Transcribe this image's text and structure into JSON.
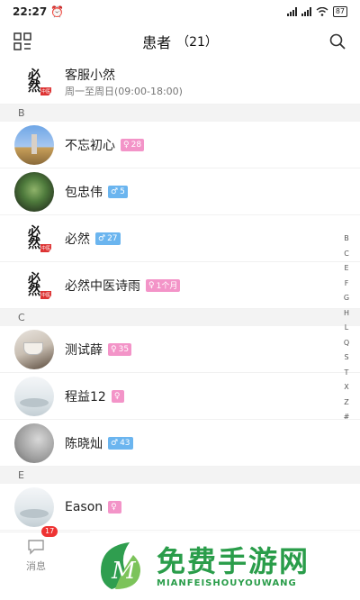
{
  "status": {
    "time": "22:27",
    "battery": "87"
  },
  "header": {
    "title": "患者",
    "count": "（21）"
  },
  "pinned": {
    "name": "客服小然",
    "subtitle": "周一至周日(09:00-18:00)",
    "avatar_text": "必然",
    "seal_text": "中医"
  },
  "sections": [
    {
      "letter": "B",
      "rows": [
        {
          "name": "不忘初心",
          "gender": "female",
          "gender_icon": "♀",
          "age": "28",
          "avatar": "sky"
        },
        {
          "name": "包忠伟",
          "gender": "male",
          "gender_icon": "♂",
          "age": "5",
          "avatar": "plant"
        },
        {
          "name": "必然",
          "gender": "male",
          "gender_icon": "♂",
          "age": "27",
          "avatar": "brand"
        },
        {
          "name": "必然中医诗雨",
          "gender": "female",
          "gender_icon": "♀",
          "age": "1个月",
          "avatar": "brand"
        }
      ]
    },
    {
      "letter": "C",
      "rows": [
        {
          "name": "测试薛",
          "gender": "female",
          "gender_icon": "♀",
          "age": "35",
          "avatar": "cup"
        },
        {
          "name": "程益12",
          "gender": "female",
          "gender_icon": "♀",
          "age": "",
          "avatar": "mist"
        },
        {
          "name": "陈晓灿",
          "gender": "male",
          "gender_icon": "♂",
          "age": "43",
          "avatar": "gray"
        }
      ]
    },
    {
      "letter": "E",
      "rows": [
        {
          "name": "Eason",
          "gender": "female",
          "gender_icon": "♀",
          "age": "",
          "avatar": "mist"
        }
      ]
    }
  ],
  "index_letters": [
    "B",
    "C",
    "E",
    "F",
    "G",
    "H",
    "L",
    "Q",
    "S",
    "T",
    "X",
    "Z",
    "#"
  ],
  "tabbar": {
    "messages_label": "消息",
    "messages_badge": "17"
  },
  "watermark": {
    "title": "免费手游网",
    "subtitle": "MIANFEISHOUYOUWANG"
  },
  "colors": {
    "female_badge": "#f394c8",
    "male_badge": "#6bb5ef",
    "brand_green": "#2a9d4a"
  }
}
